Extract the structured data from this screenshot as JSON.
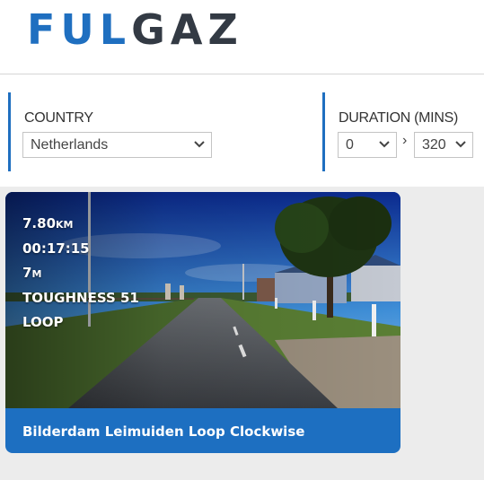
{
  "brand": {
    "logo_part1": "FUL",
    "logo_part2": "GAZ",
    "primary_color": "#1f6fc0",
    "dark_color": "#333a44"
  },
  "filters": {
    "country": {
      "label": "COUNTRY",
      "selected": "Netherlands"
    },
    "duration": {
      "label": "DURATION (MINS)",
      "min": "0",
      "separator": "›",
      "max": "320"
    }
  },
  "route_card": {
    "distance": "7.80",
    "distance_unit": "KM",
    "time": "00:17:15",
    "elevation": "7",
    "elevation_unit": "M",
    "toughness": "TOUGHNESS 51",
    "type": "LOOP",
    "title": "Bilderdam Leimuiden Loop Clockwise"
  }
}
